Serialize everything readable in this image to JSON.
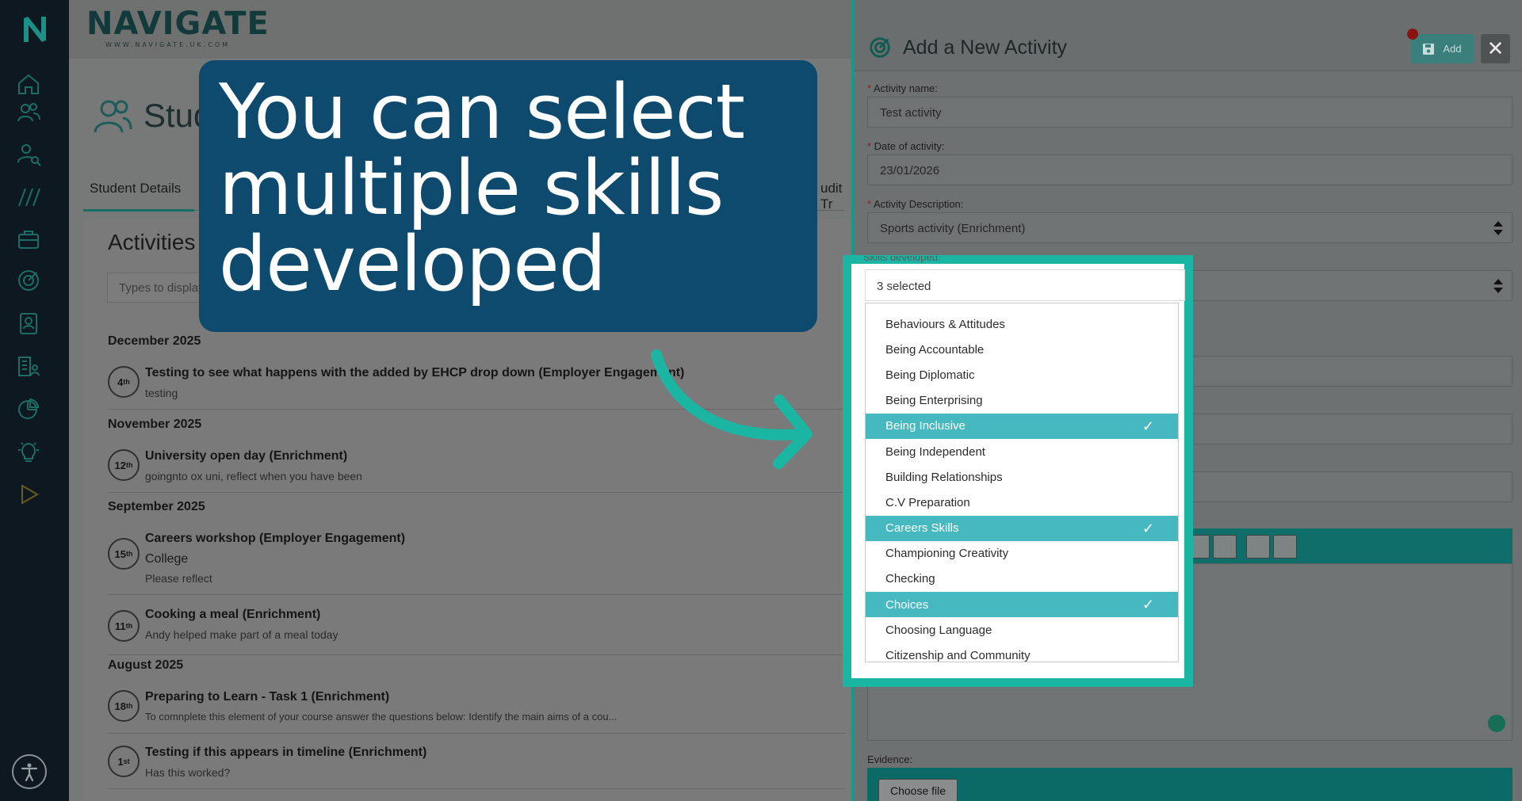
{
  "brand": {
    "name": "NAVIGATE",
    "url": "WWW.NAVIGATE.UK.COM",
    "rail_logo": "N"
  },
  "rail": {
    "icons": [
      "home-icon",
      "users-icon",
      "user-search-icon",
      "pathways-icon",
      "briefcase-icon",
      "target-icon",
      "contact-icon",
      "reports-icon",
      "pie-chart-icon",
      "lightbulb-icon",
      "play-icon"
    ],
    "accessibility": "accessibility-icon"
  },
  "page": {
    "title": "Stud"
  },
  "tabs": [
    {
      "label": "Student Details"
    },
    {
      "label": "udit Tr"
    }
  ],
  "activities": {
    "title": "Activities",
    "filter_placeholder": "Types to display",
    "groups": [
      {
        "month": "December 2025",
        "items": [
          {
            "day": "4",
            "suffix": "th",
            "title": "Testing to see what happens with the added by EHCP drop down (Employer Engagement)",
            "lines": [
              "testing"
            ]
          }
        ]
      },
      {
        "month": "November 2025",
        "items": [
          {
            "day": "12",
            "suffix": "th",
            "title": "University open day (Enrichment)",
            "lines": [
              "goingnto ox uni, reflect when you have been"
            ]
          }
        ]
      },
      {
        "month": "September 2025",
        "items": [
          {
            "day": "15",
            "suffix": "th",
            "title": "Careers workshop (Employer Engagement)",
            "lines": [
              "College",
              "Please reflect"
            ]
          },
          {
            "day": "11",
            "suffix": "th",
            "title": "Cooking a meal (Enrichment)",
            "lines": [
              "Andy helped make part of a meal today"
            ]
          }
        ]
      },
      {
        "month": "August 2025",
        "items": [
          {
            "day": "18",
            "suffix": "th",
            "title": "Preparing to Learn - Task 1 (Enrichment)",
            "lines": [
              "To comnplete this element of your course answer the questions below: Identify the main aims of a cou..."
            ]
          },
          {
            "day": "1",
            "suffix": "st",
            "title": "Testing if this appears in timeline (Enrichment)",
            "lines": [
              "Has this worked?"
            ]
          }
        ]
      }
    ]
  },
  "drawer": {
    "title": "Add a New Activity",
    "add_label": "Add",
    "close_label": "✕",
    "fields": {
      "name_label": "Activity name:",
      "name_value": "Test activity",
      "date_label": "Date of activity:",
      "date_value": "23/01/2026",
      "desc_label": "Activity Description:",
      "desc_value": "Sports activity (Enrichment)",
      "skills_label": "Skills developed:",
      "skills_value": "3 selected"
    },
    "evidence_label": "Evidence:",
    "choose_file": "Choose file"
  },
  "skills_options": [
    {
      "label": "Behaviours & Attitudes",
      "selected": false
    },
    {
      "label": "Being Accountable",
      "selected": false
    },
    {
      "label": "Being Diplomatic",
      "selected": false
    },
    {
      "label": "Being Enterprising",
      "selected": false
    },
    {
      "label": "Being Inclusive",
      "selected": true
    },
    {
      "label": "Being Independent",
      "selected": false
    },
    {
      "label": "Building Relationships",
      "selected": false
    },
    {
      "label": "C.V Preparation",
      "selected": false
    },
    {
      "label": "Careers Skills",
      "selected": true
    },
    {
      "label": "Championing Creativity",
      "selected": false
    },
    {
      "label": "Checking",
      "selected": false
    },
    {
      "label": "Choices",
      "selected": true
    },
    {
      "label": "Choosing Language",
      "selected": false
    },
    {
      "label": "Citizenship and Community",
      "selected": false
    }
  ],
  "callout": {
    "text_lines": [
      "You can select",
      "multiple skills",
      "developed"
    ]
  },
  "colors": {
    "accent": "#1bb6a3",
    "selected_option": "#46b9c0",
    "callout_bg": "#0e4a6e",
    "rail_bg": "#0d1820"
  }
}
